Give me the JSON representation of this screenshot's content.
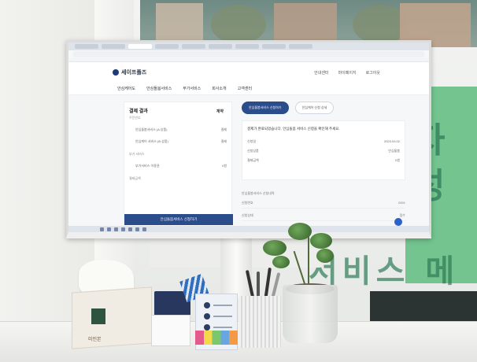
{
  "browser": {
    "tabs_count": 9
  },
  "site": {
    "logo_text": "세이프폴즈",
    "header_links": [
      "안내센터",
      "마이페이지",
      "로그아웃"
    ],
    "nav_items": [
      "안심케어도",
      "안심돌봄서비스",
      "부가서비스",
      "회사소개",
      "고객센터"
    ]
  },
  "left_card": {
    "title": "결제 결과",
    "subtitle": "주문번호",
    "side_label": "계약",
    "rows": [
      {
        "label": "안심돌봄서비스 (A 상품)",
        "value": "결제"
      },
      {
        "label": "안심케어 서비스 (B 상품)",
        "value": "결제"
      }
    ],
    "section_label": "부가 서비스",
    "extra_row": {
      "label": "부가서비스 이용권",
      "value": "0원"
    },
    "note": "결제금액",
    "cta_label": "안심돌봄서비스 신청하기"
  },
  "right_card": {
    "pills": [
      {
        "label": "안심돌봄서비스 신청하기",
        "active": true
      },
      {
        "label": "안심케어 신청 상세",
        "active": false
      }
    ],
    "info_headline": "결제가 완료되었습니다. 안심돌봄 서비스 신청을 확인해 주세요.",
    "info_rows": [
      {
        "label": "신청일",
        "value": "2023.03.02"
      },
      {
        "label": "신청상품",
        "value": "안심돌봄"
      },
      {
        "label": "결제금액",
        "value": "0원"
      }
    ],
    "list_title": "안심돌봄서비스 신청내역",
    "list_rows": [
      {
        "label": "신청번호",
        "value": "0001"
      },
      {
        "label": "신청상태",
        "value": "접수"
      }
    ]
  },
  "scene": {
    "window_sign": "자 성",
    "window_sign_lower": "서비스 메",
    "tissue_box_text": "미인본"
  }
}
